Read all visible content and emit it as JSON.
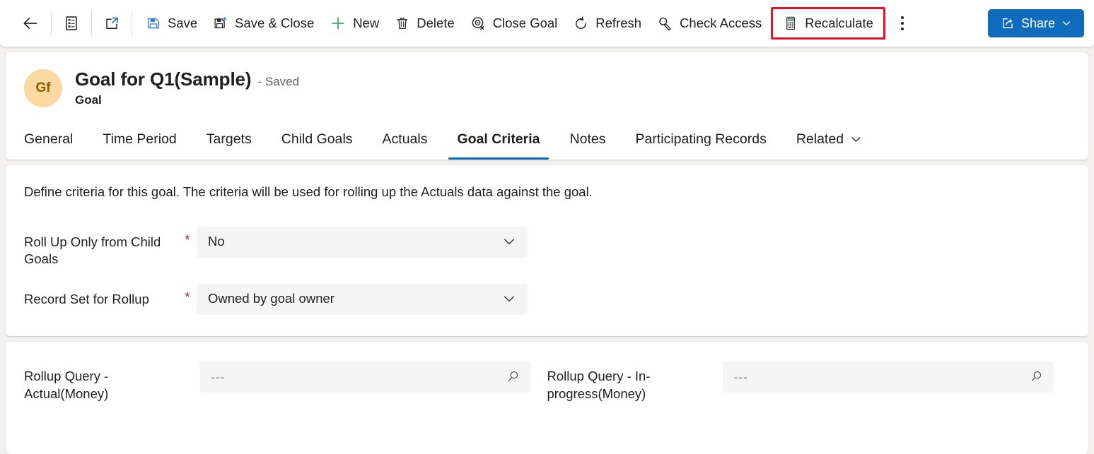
{
  "commandbar": {
    "back": {
      "label": "Back",
      "icon": "back-arrow-icon"
    },
    "form_selector": {
      "label": "Form",
      "icon": "form-list-icon"
    },
    "popout": {
      "label": "Open in new window",
      "icon": "pop-out-icon"
    },
    "buttons": [
      {
        "id": "save",
        "label": "Save",
        "icon": "save-icon"
      },
      {
        "id": "save-close",
        "label": "Save & Close",
        "icon": "save-and-close-icon"
      },
      {
        "id": "new",
        "label": "New",
        "icon": "plus-icon"
      },
      {
        "id": "delete",
        "label": "Delete",
        "icon": "trash-icon"
      },
      {
        "id": "close-goal",
        "label": "Close Goal",
        "icon": "close-goal-icon"
      },
      {
        "id": "refresh",
        "label": "Refresh",
        "icon": "refresh-icon"
      },
      {
        "id": "check-access",
        "label": "Check Access",
        "icon": "key-icon"
      },
      {
        "id": "recalculate",
        "label": "Recalculate",
        "icon": "calculator-icon"
      }
    ],
    "overflow": {
      "label": "More commands",
      "icon": "more-vertical-icon"
    },
    "share": {
      "label": "Share",
      "icon": "share-icon",
      "chevron": "chevron-down-icon"
    },
    "highlight_color": "#e81123",
    "accent_color": "#0f6cbd"
  },
  "record": {
    "avatar_initials": "Gf",
    "avatar_bg": "#fcd9a0",
    "title": "Goal for Q1(Sample)",
    "save_state": "- Saved",
    "entity": "Goal"
  },
  "tabs": {
    "items": [
      {
        "label": "General",
        "active": false
      },
      {
        "label": "Time Period",
        "active": false
      },
      {
        "label": "Targets",
        "active": false
      },
      {
        "label": "Child Goals",
        "active": false
      },
      {
        "label": "Actuals",
        "active": false
      },
      {
        "label": "Goal Criteria",
        "active": true
      },
      {
        "label": "Notes",
        "active": false
      },
      {
        "label": "Participating Records",
        "active": false
      },
      {
        "label": "Related",
        "active": false,
        "chevron": "chevron-down-icon"
      }
    ],
    "active_underline_color": "#0f6cbd"
  },
  "criteria": {
    "note": "Define criteria for this goal. The criteria will be used for rolling up the Actuals data against the goal.",
    "fields": [
      {
        "label": "Roll Up Only from Child Goals",
        "required": "*",
        "value": "No",
        "chevron": "chevron-down-icon"
      },
      {
        "label": "Record Set for Rollup",
        "required": "*",
        "value": "Owned by goal owner",
        "chevron": "chevron-down-icon"
      }
    ]
  },
  "rollup": {
    "fields": [
      {
        "label": "Rollup Query - Actual(Money)",
        "value": "---",
        "icon": "search-icon"
      },
      {
        "label": "Rollup Query - In-progress(Money)",
        "value": "---",
        "icon": "search-icon"
      }
    ]
  }
}
